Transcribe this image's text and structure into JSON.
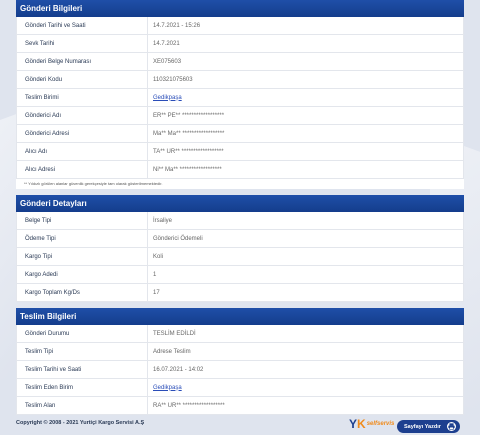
{
  "shipment_info": {
    "title": "Gönderi Bilgileri",
    "rows": [
      {
        "label": "Gönderi Tarihi ve Saati",
        "value": "14.7.2021 - 15:26"
      },
      {
        "label": "Sevk Tarihi",
        "value": "14.7.2021"
      },
      {
        "label": "Gönderi Belge Numarası",
        "value": "XE075603"
      },
      {
        "label": "Gönderi Kodu",
        "value": "110321075603"
      },
      {
        "label": "Teslim Birimi",
        "value": "Gedikpaşa"
      },
      {
        "label": "Gönderici Adı",
        "value": "ER** PE** ******************"
      },
      {
        "label": "Gönderici Adresi",
        "value": "Ma** Ma** ******************"
      },
      {
        "label": "Alıcı Adı",
        "value": "TA** UR** ******************"
      },
      {
        "label": "Alıcı Adresi",
        "value": "Ni** Ma** ******************"
      }
    ],
    "note": "** Yıldızlı görülen alanlar güvenlik gerekçesiyle tam olarak gösterilmemektedir."
  },
  "shipment_details": {
    "title": "Gönderi Detayları",
    "rows": [
      {
        "label": "Belge Tipi",
        "value": "İrsaliye"
      },
      {
        "label": "Ödeme Tipi",
        "value": "Gönderici Ödemeli"
      },
      {
        "label": "Kargo Tipi",
        "value": "Koli"
      },
      {
        "label": "Kargo Adedi",
        "value": "1"
      },
      {
        "label": "Kargo Toplam Kg/Ds",
        "value": "17"
      }
    ]
  },
  "delivery_info": {
    "title": "Teslim Bilgileri",
    "rows": [
      {
        "label": "Gönderi Durumu",
        "value": "TESLİM EDİLDİ"
      },
      {
        "label": "Teslim Tipi",
        "value": "Adrese Teslim"
      },
      {
        "label": "Teslim Tarihi ve Saati",
        "value": "16.07.2021 - 14:02"
      },
      {
        "label": "Teslim Eden Birim",
        "value": "Gedikpaşa"
      },
      {
        "label": "Teslim Alan",
        "value": "RA** UR** ******************"
      }
    ]
  },
  "footer": {
    "copyright": "Copyright © 2008 - 2021 Yurtiçi Kargo Servisi A.Ş",
    "logo_text": "selfservis",
    "print_label": "Sayfayı Yazdır",
    "print_icon": "printer-icon"
  },
  "colors": {
    "header": "#1a4699",
    "link": "#2a4db8",
    "accent": "#f08a1a"
  }
}
